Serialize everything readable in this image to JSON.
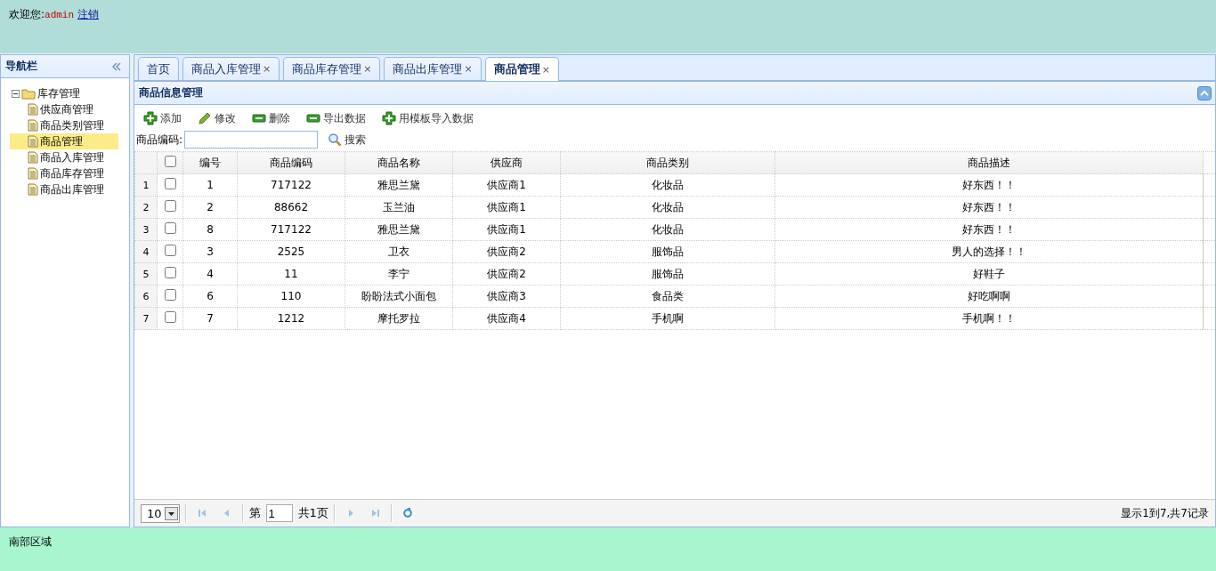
{
  "header": {
    "greeting": "欢迎您:",
    "username": "admin",
    "logout": "注销"
  },
  "nav": {
    "title": "导航栏",
    "tree": [
      {
        "label": "库存管理",
        "expanded": true,
        "selected": false,
        "children": [
          {
            "label": "供应商管理",
            "selected": false
          },
          {
            "label": "商品类别管理",
            "selected": false
          },
          {
            "label": "商品管理",
            "selected": true
          },
          {
            "label": "商品入库管理",
            "selected": false
          },
          {
            "label": "商品库存管理",
            "selected": false
          },
          {
            "label": "商品出库管理",
            "selected": false
          }
        ]
      }
    ]
  },
  "tabs": [
    {
      "label": "首页",
      "selected": false
    },
    {
      "label": "商品入库管理",
      "close": "×",
      "selected": false
    },
    {
      "label": "商品库存管理",
      "close": "×",
      "selected": false
    },
    {
      "label": "商品出库管理",
      "close": "×",
      "selected": false
    },
    {
      "label": "商品管理",
      "close": "×",
      "selected": true
    }
  ],
  "panel": {
    "title": "商品信息管理",
    "toolbar": [
      {
        "kind": "add",
        "label": "添加"
      },
      {
        "kind": "edit",
        "label": "修改"
      },
      {
        "kind": "remove",
        "label": "删除"
      },
      {
        "kind": "remove",
        "label": "导出数据"
      },
      {
        "kind": "add",
        "label": "用模板导入数据"
      }
    ],
    "search": {
      "label": "商品编码:",
      "button": "搜索"
    },
    "table": {
      "all_checked": false,
      "columns": [
        "编号",
        "商品编码",
        "商品名称",
        "供应商",
        "商品类别",
        "商品描述"
      ],
      "rows": [
        {
          "row_number": "1",
          "checked": false,
          "cells": [
            "1",
            "717122",
            "雅思兰黛",
            "供应商1",
            "化妆品",
            "好东西！！"
          ]
        },
        {
          "row_number": "2",
          "checked": false,
          "cells": [
            "2",
            "88662",
            "玉兰油",
            "供应商1",
            "化妆品",
            "好东西！！"
          ]
        },
        {
          "row_number": "3",
          "checked": false,
          "cells": [
            "8",
            "717122",
            "雅思兰黛",
            "供应商1",
            "化妆品",
            "好东西！！"
          ]
        },
        {
          "row_number": "4",
          "checked": false,
          "cells": [
            "3",
            "2525",
            "卫衣",
            "供应商2",
            "服饰品",
            "男人的选择！！"
          ]
        },
        {
          "row_number": "5",
          "checked": false,
          "cells": [
            "4",
            "11",
            "李宁",
            "供应商2",
            "服饰品",
            "好鞋子"
          ]
        },
        {
          "row_number": "6",
          "checked": false,
          "cells": [
            "6",
            "110",
            "盼盼法式小面包",
            "供应商3",
            "食品类",
            "好吃啊啊"
          ]
        },
        {
          "row_number": "7",
          "checked": false,
          "cells": [
            "7",
            "1212",
            "摩托罗拉",
            "供应商4",
            "手机啊",
            "手机啊！！"
          ]
        }
      ]
    },
    "pager": {
      "page_size": "10",
      "page_prefix": "第",
      "page": "1",
      "page_total": "共1页",
      "summary": "显示1到7,共7记录"
    }
  },
  "footer": {
    "text": "南部区域"
  }
}
